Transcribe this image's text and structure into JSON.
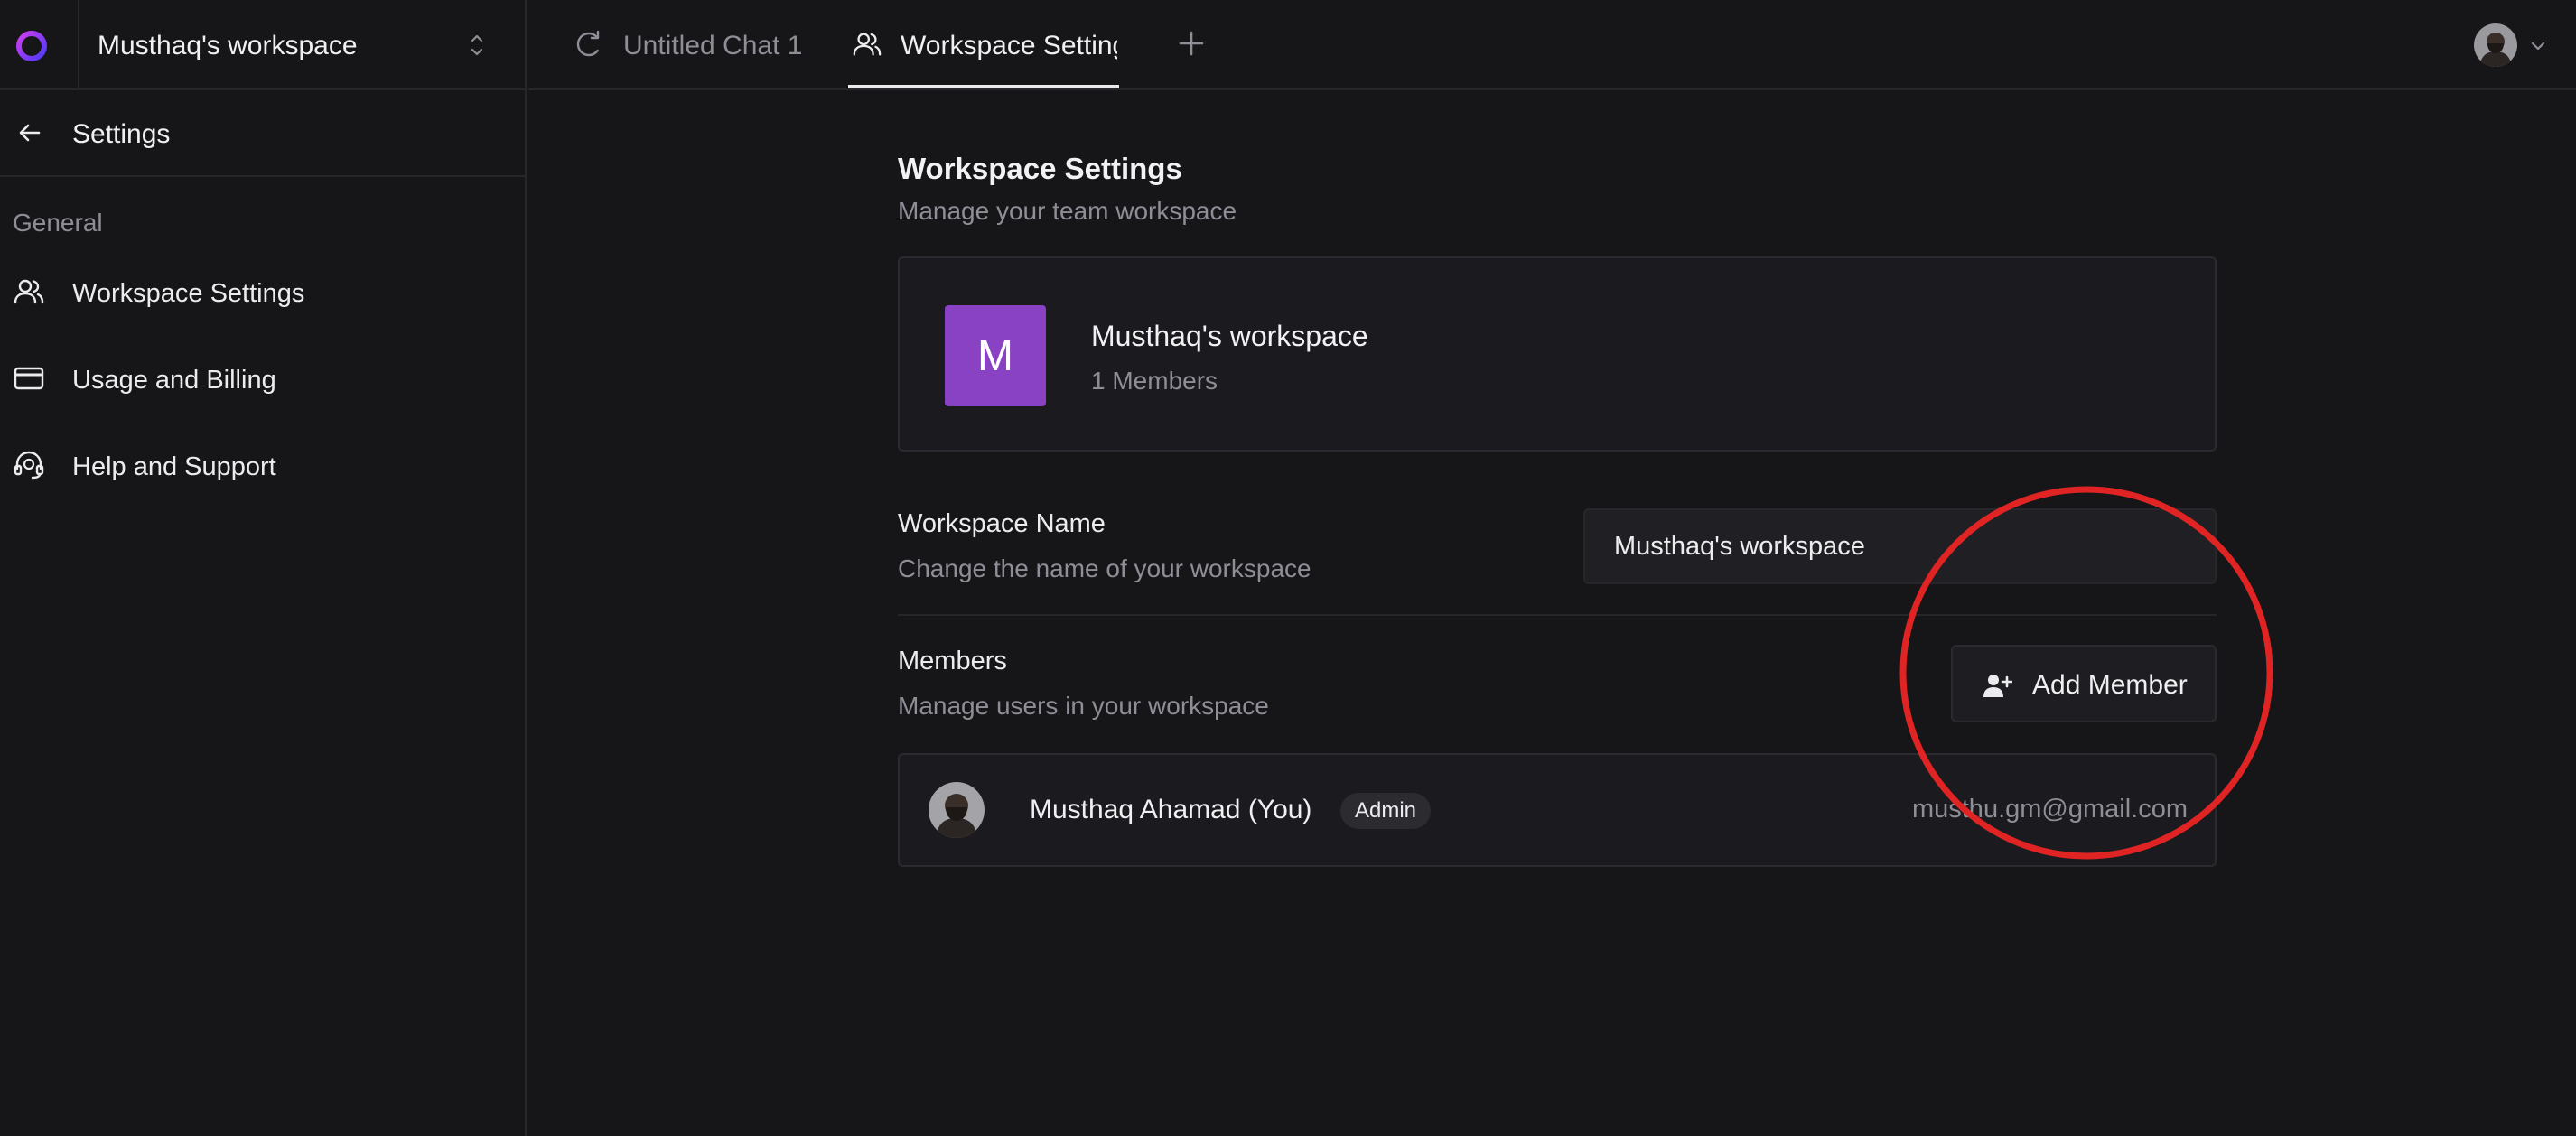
{
  "sidebar": {
    "workspace_name": "Musthaq's workspace",
    "settings_title": "Settings",
    "section_label": "General",
    "items": [
      {
        "label": "Workspace Settings",
        "icon": "users-icon"
      },
      {
        "label": "Usage and Billing",
        "icon": "credit-card-icon"
      },
      {
        "label": "Help and Support",
        "icon": "headset-icon"
      }
    ]
  },
  "tabs": [
    {
      "label": "Untitled Chat 1",
      "icon": "chat-refresh-icon",
      "active": false
    },
    {
      "label": "Workspace Settings",
      "icon": "users-icon",
      "active": true
    }
  ],
  "main": {
    "title": "Workspace Settings",
    "subtitle": "Manage your team workspace",
    "workspace_card": {
      "initial": "M",
      "name": "Musthaq's workspace",
      "members_count": "1 Members",
      "color": "#8a42c4"
    },
    "name_field": {
      "label": "Workspace Name",
      "description": "Change the name of your workspace",
      "value": "Musthaq's workspace"
    },
    "members": {
      "label": "Members",
      "description": "Manage users in your workspace",
      "add_button": "Add Member",
      "list": [
        {
          "name": "Musthaq Ahamad (You)",
          "role": "Admin",
          "email": "musthu.gm@gmail.com"
        }
      ]
    }
  },
  "colors": {
    "background": "#161619",
    "border": "#26262b",
    "muted_text": "#8e8e96",
    "annotation": "#e02424"
  }
}
